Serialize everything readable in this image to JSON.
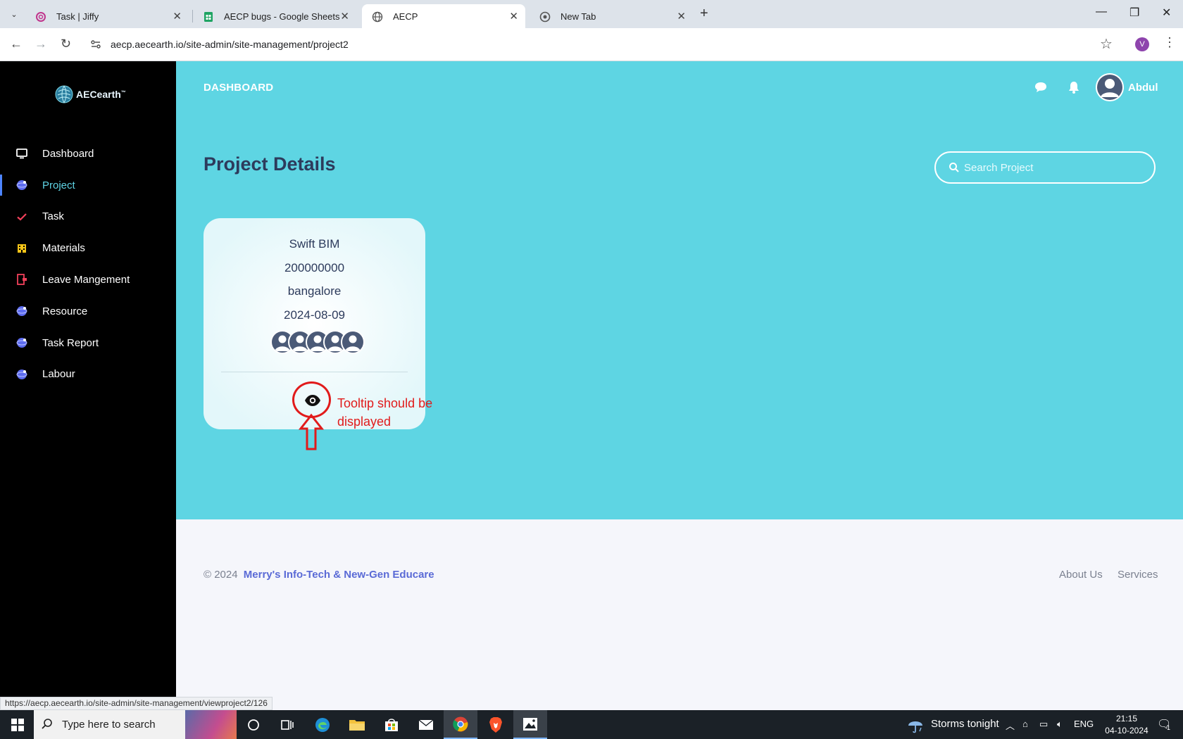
{
  "browser": {
    "tabs": [
      {
        "title": "Task | Jiffy",
        "active": false
      },
      {
        "title": "AECP bugs - Google Sheets",
        "active": false
      },
      {
        "title": "AECP",
        "active": true
      },
      {
        "title": "New Tab",
        "active": false
      }
    ],
    "url": "aecp.aecearth.io/site-admin/site-management/project2",
    "profile_initial": "V",
    "status_url": "https://aecp.aecearth.io/site-admin/site-management/viewproject2/126"
  },
  "app": {
    "logo_text": "AECearth",
    "logo_tm": "™",
    "header_title": "DASHBOARD",
    "user_name": "Abdul",
    "page_title": "Project Details",
    "search_placeholder": "Search Project"
  },
  "sidebar": {
    "items": [
      {
        "label": "Dashboard",
        "icon": "monitor-icon",
        "active": false
      },
      {
        "label": "Project",
        "icon": "globe-icon",
        "active": true
      },
      {
        "label": "Task",
        "icon": "check-icon",
        "active": false
      },
      {
        "label": "Materials",
        "icon": "building-icon",
        "active": false
      },
      {
        "label": "Leave Mangement",
        "icon": "leave-icon",
        "active": false
      },
      {
        "label": "Resource",
        "icon": "globe-icon",
        "active": false
      },
      {
        "label": "Task Report",
        "icon": "globe-icon",
        "active": false
      },
      {
        "label": "Labour",
        "icon": "globe-icon",
        "active": false
      }
    ]
  },
  "project_card": {
    "name": "Swift BIM",
    "number": "200000000",
    "location": "bangalore",
    "date": "2024-08-09",
    "member_count": 5,
    "action_icon": "eye-icon"
  },
  "annotation": {
    "text_line1": "Tooltip should be",
    "text_line2": "displayed",
    "color": "#e11b1b"
  },
  "footer": {
    "copyright": "© 2024",
    "company": "Merry's Info-Tech & New-Gen Educare",
    "links": [
      "About Us",
      "Services"
    ]
  },
  "taskbar": {
    "search_placeholder": "Type here to search",
    "weather": "Storms tonight",
    "language": "ENG",
    "time": "21:15",
    "date": "04-10-2024",
    "notification_count": "1"
  },
  "colors": {
    "main_bg": "#5ed5e3",
    "sidebar_bg": "#000000",
    "title_text": "#2d3b5c",
    "accent_link": "#5a6ad6"
  }
}
